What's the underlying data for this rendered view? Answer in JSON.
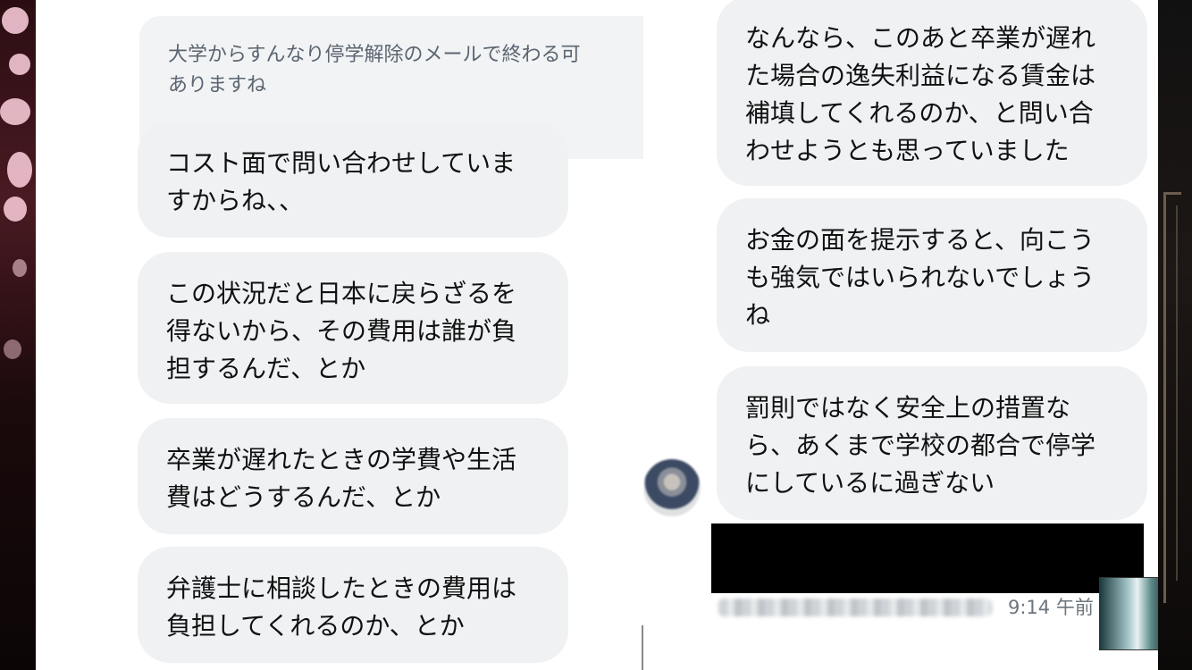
{
  "left_chat": {
    "quoted_message": "大学からすんなり停学解除のメールで終わる可\nありますね",
    "messages": [
      "コスト面で問い合わせしていま\nすからね、、",
      "この状況だと日本に戻らざるを\n得ないから、その費用は誰が負\n担するんだ、とか",
      "卒業が遅れたときの学費や生活\n費はどうするんだ、とか",
      "弁護士に相談したときの費用は\n負担してくれるのか、とか"
    ]
  },
  "right_chat": {
    "messages": [
      "なんなら、このあと卒業が遅れ\nた場合の逸失利益になる賃金は\n補填してくれるのか、と問い合\nわせようとも思っていました",
      "お金の面を提示すると、向こう\nも強気ではいられないでしょう\nね",
      "罰則ではなく安全上の措置な\nら、あくまで学校の都合で停学\nにしているに過ぎない"
    ],
    "timestamp": "9:14 午前"
  },
  "icons": {
    "avatar": "user-avatar-blurred",
    "thumbnail": "video-thumbnail"
  }
}
